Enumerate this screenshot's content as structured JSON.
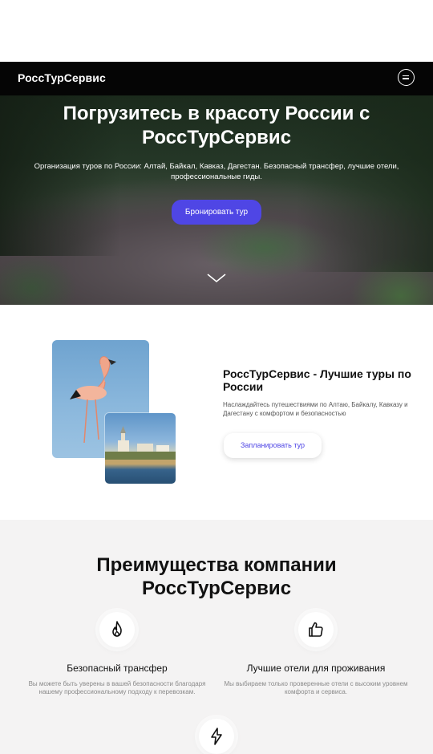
{
  "navbar": {
    "brand": "РоссТурСервис",
    "menu_icon": "menu-icon"
  },
  "hero": {
    "title": "Погрузитесь в красоту России с РоссТурСервис",
    "subtitle": "Организация туров по России: Алтай, Байкал, Кавказ, Дагестан. Безопасный трансфер, лучшие отели, профессиональные гиды.",
    "cta_label": "Бронировать тур",
    "scroll_icon": "chevron-down-icon"
  },
  "intro": {
    "title": "РоссТурСервис - Лучшие туры по России",
    "text": "Наслаждайтесь путешествиями по Алтаю, Байкалу, Кавказу и Дагестану с комфортом и безопасностью",
    "button_label": "Запланировать тур"
  },
  "benefits": {
    "title": "Преимущества компании РоссТурСервис",
    "items": [
      {
        "icon": "flame-icon",
        "title": "Безопасный трансфер",
        "text": "Вы можете быть уверены в вашей безопасности благодаря нашему профессиональному подходу к перевозкам."
      },
      {
        "icon": "thumbs-up-icon",
        "title": "Лучшие отели для проживания",
        "text": "Мы выбираем только проверенные отели с высоким уровнем комфорта и сервиса."
      },
      {
        "icon": "lightning-icon"
      }
    ]
  },
  "colors": {
    "accent": "#4f46e5",
    "navbar": "#050505",
    "benefits_bg": "#f4f3f3"
  }
}
